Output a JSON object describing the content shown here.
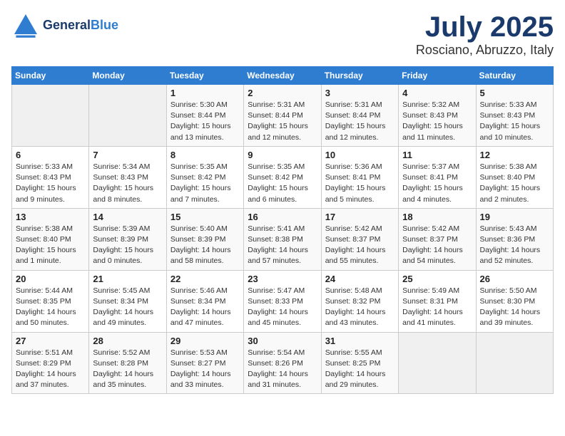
{
  "header": {
    "logo_general": "General",
    "logo_blue": "Blue",
    "month": "July 2025",
    "location": "Rosciano, Abruzzo, Italy"
  },
  "days_of_week": [
    "Sunday",
    "Monday",
    "Tuesday",
    "Wednesday",
    "Thursday",
    "Friday",
    "Saturday"
  ],
  "weeks": [
    [
      {
        "day": "",
        "info": ""
      },
      {
        "day": "",
        "info": ""
      },
      {
        "day": "1",
        "info": "Sunrise: 5:30 AM\nSunset: 8:44 PM\nDaylight: 15 hours\nand 13 minutes."
      },
      {
        "day": "2",
        "info": "Sunrise: 5:31 AM\nSunset: 8:44 PM\nDaylight: 15 hours\nand 12 minutes."
      },
      {
        "day": "3",
        "info": "Sunrise: 5:31 AM\nSunset: 8:44 PM\nDaylight: 15 hours\nand 12 minutes."
      },
      {
        "day": "4",
        "info": "Sunrise: 5:32 AM\nSunset: 8:43 PM\nDaylight: 15 hours\nand 11 minutes."
      },
      {
        "day": "5",
        "info": "Sunrise: 5:33 AM\nSunset: 8:43 PM\nDaylight: 15 hours\nand 10 minutes."
      }
    ],
    [
      {
        "day": "6",
        "info": "Sunrise: 5:33 AM\nSunset: 8:43 PM\nDaylight: 15 hours\nand 9 minutes."
      },
      {
        "day": "7",
        "info": "Sunrise: 5:34 AM\nSunset: 8:43 PM\nDaylight: 15 hours\nand 8 minutes."
      },
      {
        "day": "8",
        "info": "Sunrise: 5:35 AM\nSunset: 8:42 PM\nDaylight: 15 hours\nand 7 minutes."
      },
      {
        "day": "9",
        "info": "Sunrise: 5:35 AM\nSunset: 8:42 PM\nDaylight: 15 hours\nand 6 minutes."
      },
      {
        "day": "10",
        "info": "Sunrise: 5:36 AM\nSunset: 8:41 PM\nDaylight: 15 hours\nand 5 minutes."
      },
      {
        "day": "11",
        "info": "Sunrise: 5:37 AM\nSunset: 8:41 PM\nDaylight: 15 hours\nand 4 minutes."
      },
      {
        "day": "12",
        "info": "Sunrise: 5:38 AM\nSunset: 8:40 PM\nDaylight: 15 hours\nand 2 minutes."
      }
    ],
    [
      {
        "day": "13",
        "info": "Sunrise: 5:38 AM\nSunset: 8:40 PM\nDaylight: 15 hours\nand 1 minute."
      },
      {
        "day": "14",
        "info": "Sunrise: 5:39 AM\nSunset: 8:39 PM\nDaylight: 15 hours\nand 0 minutes."
      },
      {
        "day": "15",
        "info": "Sunrise: 5:40 AM\nSunset: 8:39 PM\nDaylight: 14 hours\nand 58 minutes."
      },
      {
        "day": "16",
        "info": "Sunrise: 5:41 AM\nSunset: 8:38 PM\nDaylight: 14 hours\nand 57 minutes."
      },
      {
        "day": "17",
        "info": "Sunrise: 5:42 AM\nSunset: 8:37 PM\nDaylight: 14 hours\nand 55 minutes."
      },
      {
        "day": "18",
        "info": "Sunrise: 5:42 AM\nSunset: 8:37 PM\nDaylight: 14 hours\nand 54 minutes."
      },
      {
        "day": "19",
        "info": "Sunrise: 5:43 AM\nSunset: 8:36 PM\nDaylight: 14 hours\nand 52 minutes."
      }
    ],
    [
      {
        "day": "20",
        "info": "Sunrise: 5:44 AM\nSunset: 8:35 PM\nDaylight: 14 hours\nand 50 minutes."
      },
      {
        "day": "21",
        "info": "Sunrise: 5:45 AM\nSunset: 8:34 PM\nDaylight: 14 hours\nand 49 minutes."
      },
      {
        "day": "22",
        "info": "Sunrise: 5:46 AM\nSunset: 8:34 PM\nDaylight: 14 hours\nand 47 minutes."
      },
      {
        "day": "23",
        "info": "Sunrise: 5:47 AM\nSunset: 8:33 PM\nDaylight: 14 hours\nand 45 minutes."
      },
      {
        "day": "24",
        "info": "Sunrise: 5:48 AM\nSunset: 8:32 PM\nDaylight: 14 hours\nand 43 minutes."
      },
      {
        "day": "25",
        "info": "Sunrise: 5:49 AM\nSunset: 8:31 PM\nDaylight: 14 hours\nand 41 minutes."
      },
      {
        "day": "26",
        "info": "Sunrise: 5:50 AM\nSunset: 8:30 PM\nDaylight: 14 hours\nand 39 minutes."
      }
    ],
    [
      {
        "day": "27",
        "info": "Sunrise: 5:51 AM\nSunset: 8:29 PM\nDaylight: 14 hours\nand 37 minutes."
      },
      {
        "day": "28",
        "info": "Sunrise: 5:52 AM\nSunset: 8:28 PM\nDaylight: 14 hours\nand 35 minutes."
      },
      {
        "day": "29",
        "info": "Sunrise: 5:53 AM\nSunset: 8:27 PM\nDaylight: 14 hours\nand 33 minutes."
      },
      {
        "day": "30",
        "info": "Sunrise: 5:54 AM\nSunset: 8:26 PM\nDaylight: 14 hours\nand 31 minutes."
      },
      {
        "day": "31",
        "info": "Sunrise: 5:55 AM\nSunset: 8:25 PM\nDaylight: 14 hours\nand 29 minutes."
      },
      {
        "day": "",
        "info": ""
      },
      {
        "day": "",
        "info": ""
      }
    ]
  ]
}
